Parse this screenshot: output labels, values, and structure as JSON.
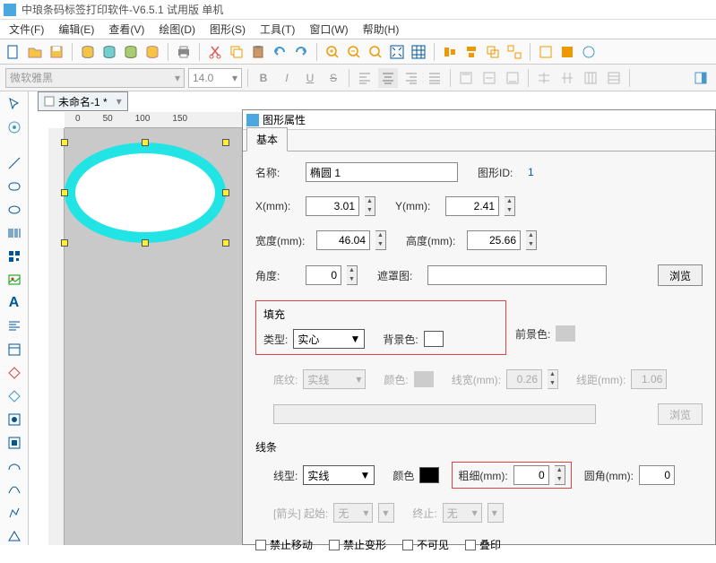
{
  "titlebar": "中琅条码标签打印软件-V6.5.1 试用版 单机",
  "menu": {
    "file": "文件(F)",
    "edit": "编辑(E)",
    "view": "查看(V)",
    "draw": "绘图(D)",
    "shape": "图形(S)",
    "tool": "工具(T)",
    "window": "窗口(W)",
    "help": "帮助(H)"
  },
  "format": {
    "font": "微软雅黑",
    "size": "14.0",
    "bold": "B",
    "italic": "I",
    "underline": "U",
    "strike": "S"
  },
  "doc_tab": "未命名-1 *",
  "panel": {
    "title": "图形属性",
    "tab": "基本",
    "name_lbl": "名称:",
    "name_val": "椭圆 1",
    "id_lbl": "图形ID:",
    "id_val": "1",
    "x_lbl": "X(mm):",
    "x_val": "3.01",
    "y_lbl": "Y(mm):",
    "y_val": "2.41",
    "w_lbl": "宽度(mm):",
    "w_val": "46.04",
    "h_lbl": "高度(mm):",
    "h_val": "25.66",
    "angle_lbl": "角度:",
    "angle_val": "0",
    "mask_lbl": "遮罩图:",
    "browse": "浏览",
    "fill_lbl": "填充",
    "type_lbl": "类型:",
    "type_val": "实心",
    "bg_lbl": "背景色:",
    "fg_lbl": "前景色:",
    "pattern_lbl": "底纹:",
    "pattern_val": "实线",
    "color_lbl": "颜色:",
    "lw_lbl": "线宽(mm):",
    "lw_val": "0.26",
    "ld_lbl": "线距(mm):",
    "ld_val": "1.06",
    "line_lbl": "线条",
    "ltype_lbl": "线型:",
    "ltype_val": "实线",
    "lcolor_lbl": "颜色",
    "thick_lbl": "粗细(mm):",
    "thick_val": "0",
    "radius_lbl": "圆角(mm):",
    "radius_val": "0",
    "arrow_lbl": "[箭头] 起始:",
    "arrow_start": "无",
    "arrow_end_lbl": "终止:",
    "arrow_end": "无",
    "chk_lock": "禁止移动",
    "chk_noresize": "禁止变形",
    "chk_hidden": "不可见",
    "chk_overprint": "叠印"
  }
}
